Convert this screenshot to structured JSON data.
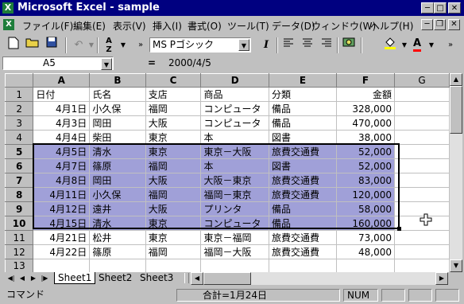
{
  "window": {
    "title": "Microsoft Excel - sample",
    "app_icon": "X"
  },
  "menu": [
    "ファイル(F)",
    "編集(E)",
    "表示(V)",
    "挿入(I)",
    "書式(O)",
    "ツール(T)",
    "データ(D)",
    "ウィンドウ(W)",
    "ヘルプ(H)"
  ],
  "toolbar": {
    "font_name": "MS Pゴシック",
    "italic_label": "I"
  },
  "formula_bar": {
    "cell_ref": "A5",
    "equals": "=",
    "content": "2000/4/5"
  },
  "sheet": {
    "columns": [
      "A",
      "B",
      "C",
      "D",
      "E",
      "F",
      "G"
    ],
    "rows": [
      {
        "num": "1",
        "cells": [
          "日付",
          "氏名",
          "支店",
          "商品",
          "分類",
          "金額",
          ""
        ]
      },
      {
        "num": "2",
        "cells": [
          "4月1日",
          "小久保",
          "福岡",
          "コンピュータ",
          "備品",
          "328,000",
          ""
        ]
      },
      {
        "num": "3",
        "cells": [
          "4月3日",
          "岡田",
          "大阪",
          "コンピュータ",
          "備品",
          "470,000",
          ""
        ]
      },
      {
        "num": "4",
        "cells": [
          "4月4日",
          "柴田",
          "東京",
          "本",
          "図書",
          "38,000",
          ""
        ]
      },
      {
        "num": "5",
        "cells": [
          "4月5日",
          "清水",
          "東京",
          "東京－大阪",
          "旅費交通費",
          "52,000",
          ""
        ]
      },
      {
        "num": "6",
        "cells": [
          "4月7日",
          "篠原",
          "福岡",
          "本",
          "図書",
          "52,000",
          ""
        ]
      },
      {
        "num": "7",
        "cells": [
          "4月8日",
          "岡田",
          "大阪",
          "大阪－東京",
          "旅費交通費",
          "83,000",
          ""
        ]
      },
      {
        "num": "8",
        "cells": [
          "4月11日",
          "小久保",
          "福岡",
          "福岡－東京",
          "旅費交通費",
          "120,000",
          ""
        ]
      },
      {
        "num": "9",
        "cells": [
          "4月12日",
          "遠井",
          "大阪",
          "プリンタ",
          "備品",
          "58,000",
          ""
        ]
      },
      {
        "num": "10",
        "cells": [
          "4月15日",
          "清水",
          "東京",
          "コンピュータ",
          "備品",
          "160,000",
          ""
        ]
      },
      {
        "num": "11",
        "cells": [
          "4月21日",
          "松井",
          "東京",
          "東京－福岡",
          "旅費交通費",
          "73,000",
          ""
        ]
      },
      {
        "num": "12",
        "cells": [
          "4月22日",
          "篠原",
          "福岡",
          "福岡－大阪",
          "旅費交通費",
          "48,000",
          ""
        ]
      },
      {
        "num": "13",
        "cells": [
          "",
          "",
          "",
          "",
          "",
          "",
          ""
        ]
      }
    ],
    "selected_rows": [
      "5",
      "6",
      "7",
      "8",
      "9",
      "10"
    ],
    "selection_color": "#a0a0d8"
  },
  "tabs": [
    "Sheet1",
    "Sheet2",
    "Sheet3"
  ],
  "active_tab": "Sheet1",
  "status": {
    "mode": "コマンド",
    "sum": "合計=1月24日",
    "num": "NUM"
  }
}
